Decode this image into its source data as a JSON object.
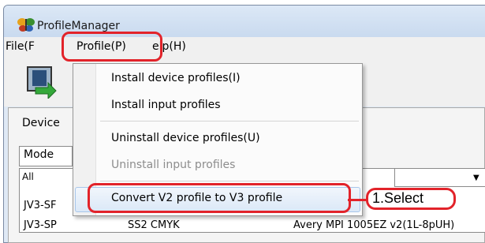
{
  "window": {
    "title": "ProfileManager"
  },
  "menubar": {
    "file": "File(F",
    "profile": "Profile(P)",
    "help": "elp(H)"
  },
  "panel": {
    "tab_label": "Device",
    "model_label": "Mode",
    "filter_value": "All"
  },
  "list": {
    "rows": [
      {
        "model": "JV3-SF",
        "profile": "",
        "media": ""
      },
      {
        "model": "JV3-SP",
        "profile": "SS2 CMYK",
        "media": "Avery MPI 1005EZ v2(1L-8pUH)"
      }
    ]
  },
  "profile_menu": {
    "items": [
      {
        "label": "Install device profiles(I)",
        "enabled": true
      },
      {
        "label": "Install input profiles",
        "enabled": true
      },
      {
        "label": "Uninstall device profiles(U)",
        "enabled": true
      },
      {
        "label": "Uninstall input profiles",
        "enabled": false
      },
      {
        "label": "Convert V2 profile to V3 profile",
        "enabled": true,
        "highlighted": true
      }
    ]
  },
  "annotation": {
    "callout": "1.Select",
    "color": "#e2232a"
  },
  "icons": {
    "app": "butterfly-app-icon",
    "toolbar": "device-profile-icon"
  }
}
